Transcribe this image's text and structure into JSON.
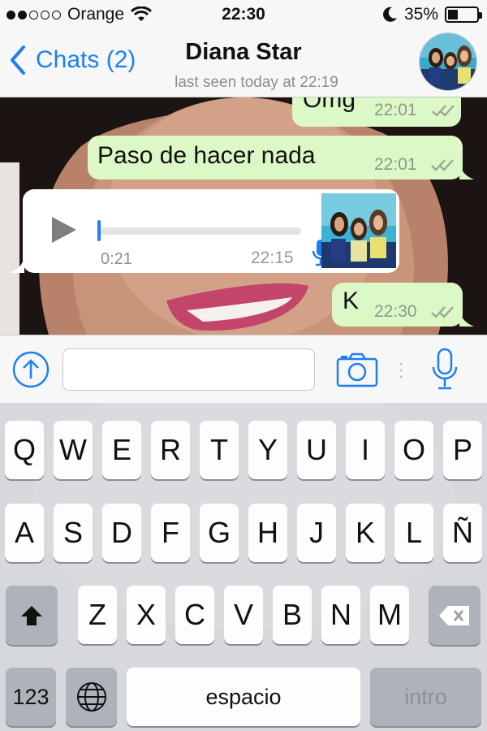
{
  "status_bar": {
    "carrier": "Orange",
    "signal_bars_filled": 2,
    "signal_bars_total": 5,
    "time": "22:30",
    "battery_percent": "35%",
    "battery_level": 0.35
  },
  "nav": {
    "back_label": "Chats (2)",
    "title": "Diana Star",
    "subtitle": "last seen today at 22:19",
    "accent_color": "#1e7ff0"
  },
  "messages": [
    {
      "direction": "out",
      "text": "Omg",
      "time": "22:01"
    },
    {
      "direction": "out",
      "text": "Paso de hacer nada",
      "time": "22:01"
    },
    {
      "direction": "in",
      "type": "voice",
      "duration": "0:21",
      "time": "22:15",
      "progress": 0.0
    },
    {
      "direction": "out",
      "text": "K",
      "time": "22:30"
    }
  ],
  "input_bar": {
    "text_value": "",
    "placeholder": ""
  },
  "keyboard": {
    "row1": [
      "Q",
      "W",
      "E",
      "R",
      "T",
      "Y",
      "U",
      "I",
      "O",
      "P"
    ],
    "row2": [
      "A",
      "S",
      "D",
      "F",
      "G",
      "H",
      "J",
      "K",
      "L",
      "Ñ"
    ],
    "row3": [
      "Z",
      "X",
      "C",
      "V",
      "B",
      "N",
      "M"
    ],
    "numbers_label": "123",
    "space_label": "espacio",
    "return_label": "intro"
  },
  "colors": {
    "bubble_out": "#dcf8c6",
    "bubble_in": "#ffffff",
    "ios_blue": "#1e7ff0"
  }
}
